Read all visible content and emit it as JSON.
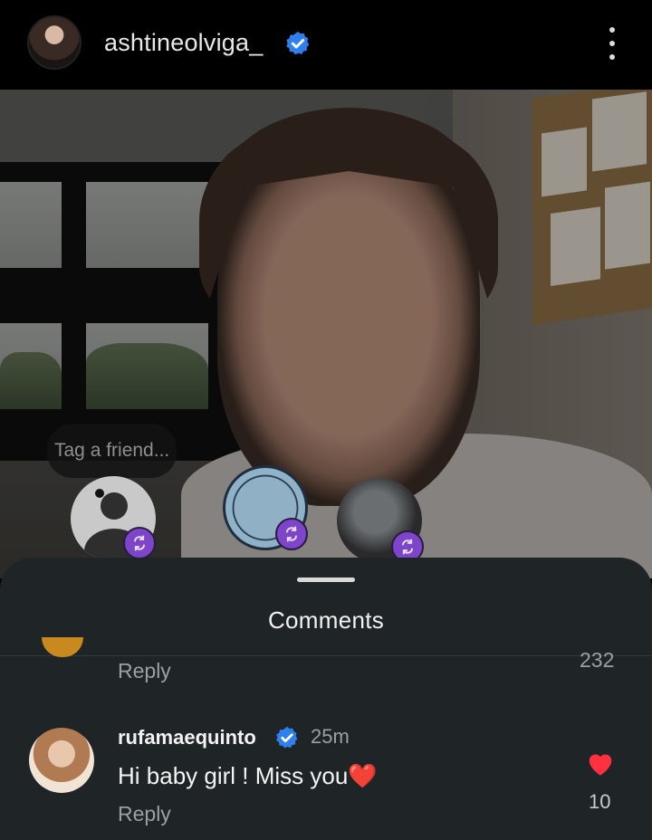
{
  "header": {
    "username": "ashtineolviga_",
    "verified_icon": "verified-badge-icon",
    "more_icon": "more-vertical-icon"
  },
  "photo": {
    "tag_prompt": "Tag a friend..."
  },
  "comments_sheet": {
    "title": "Comments",
    "previous_comment": {
      "reply_label": "Reply",
      "like_count": "232"
    },
    "comment": {
      "username": "rufamaequinto",
      "time": "25m",
      "text": "Hi baby girl ! Miss you❤️",
      "reply_label": "Reply",
      "like_count": "10",
      "liked": true
    }
  },
  "colors": {
    "verified_blue": "#2f80ed",
    "like_red": "#ff3040",
    "swap_purple": "#7d45c9",
    "sheet_bg": "#1f2427"
  }
}
